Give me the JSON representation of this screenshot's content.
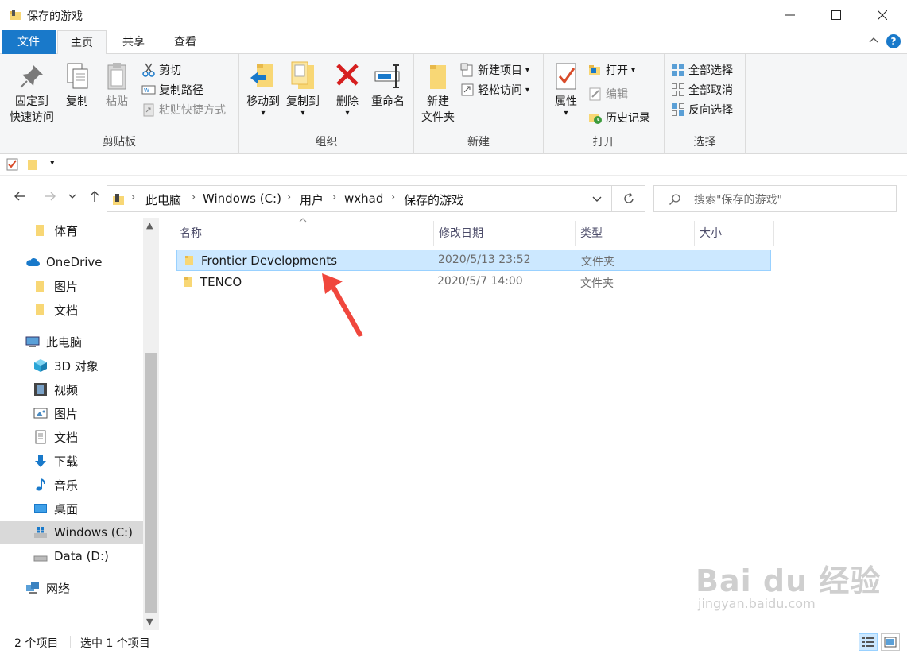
{
  "window": {
    "title": "保存的游戏"
  },
  "ribbon_tabs": {
    "file": "文件",
    "home": "主页",
    "share": "共享",
    "view": "查看"
  },
  "ribbon": {
    "clipboard": {
      "label": "剪贴板",
      "pin": "固定到",
      "pin2": "快速访问",
      "copy": "复制",
      "paste": "粘贴",
      "cut": "剪切",
      "copy_path": "复制路径",
      "paste_shortcut": "粘贴快捷方式"
    },
    "organize": {
      "label": "组织",
      "move_to": "移动到",
      "copy_to": "复制到",
      "delete": "删除",
      "rename": "重命名"
    },
    "new": {
      "label": "新建",
      "new_folder": "新建",
      "new_folder2": "文件夹",
      "new_item": "新建项目",
      "easy_access": "轻松访问"
    },
    "open": {
      "label": "打开",
      "properties": "属性",
      "open": "打开",
      "edit": "编辑",
      "history": "历史记录"
    },
    "select": {
      "label": "选择",
      "select_all": "全部选择",
      "select_none": "全部取消",
      "invert": "反向选择"
    }
  },
  "breadcrumb": [
    "此电脑",
    "Windows (C:)",
    "用户",
    "wxhad",
    "保存的游戏"
  ],
  "search": {
    "placeholder": "搜索\"保存的游戏\""
  },
  "nav": [
    {
      "label": "体育",
      "icon": "folder-icon"
    },
    {
      "label": "OneDrive",
      "icon": "cloud-icon"
    },
    {
      "label": "图片",
      "icon": "folder-icon"
    },
    {
      "label": "文档",
      "icon": "folder-icon"
    },
    {
      "label": "此电脑",
      "icon": "computer-icon"
    },
    {
      "label": "3D 对象",
      "icon": "cube-icon"
    },
    {
      "label": "视频",
      "icon": "film-icon"
    },
    {
      "label": "图片",
      "icon": "picture-icon"
    },
    {
      "label": "文档",
      "icon": "document-icon"
    },
    {
      "label": "下载",
      "icon": "download-icon"
    },
    {
      "label": "音乐",
      "icon": "music-icon"
    },
    {
      "label": "桌面",
      "icon": "desktop-icon"
    },
    {
      "label": "Windows (C:)",
      "icon": "drive-icon"
    },
    {
      "label": "Data (D:)",
      "icon": "drive-icon"
    },
    {
      "label": "网络",
      "icon": "network-icon"
    }
  ],
  "columns": {
    "name": "名称",
    "modified": "修改日期",
    "type": "类型",
    "size": "大小"
  },
  "files": [
    {
      "name": "Frontier Developments",
      "modified": "2020/5/13 23:52",
      "type": "文件夹"
    },
    {
      "name": "TENCO",
      "modified": "2020/5/7 14:00",
      "type": "文件夹"
    }
  ],
  "status": {
    "count": "2 个项目",
    "selected": "选中 1 个项目"
  },
  "watermark": {
    "logo": "Bai du 经验",
    "url": "jingyan.baidu.com"
  }
}
